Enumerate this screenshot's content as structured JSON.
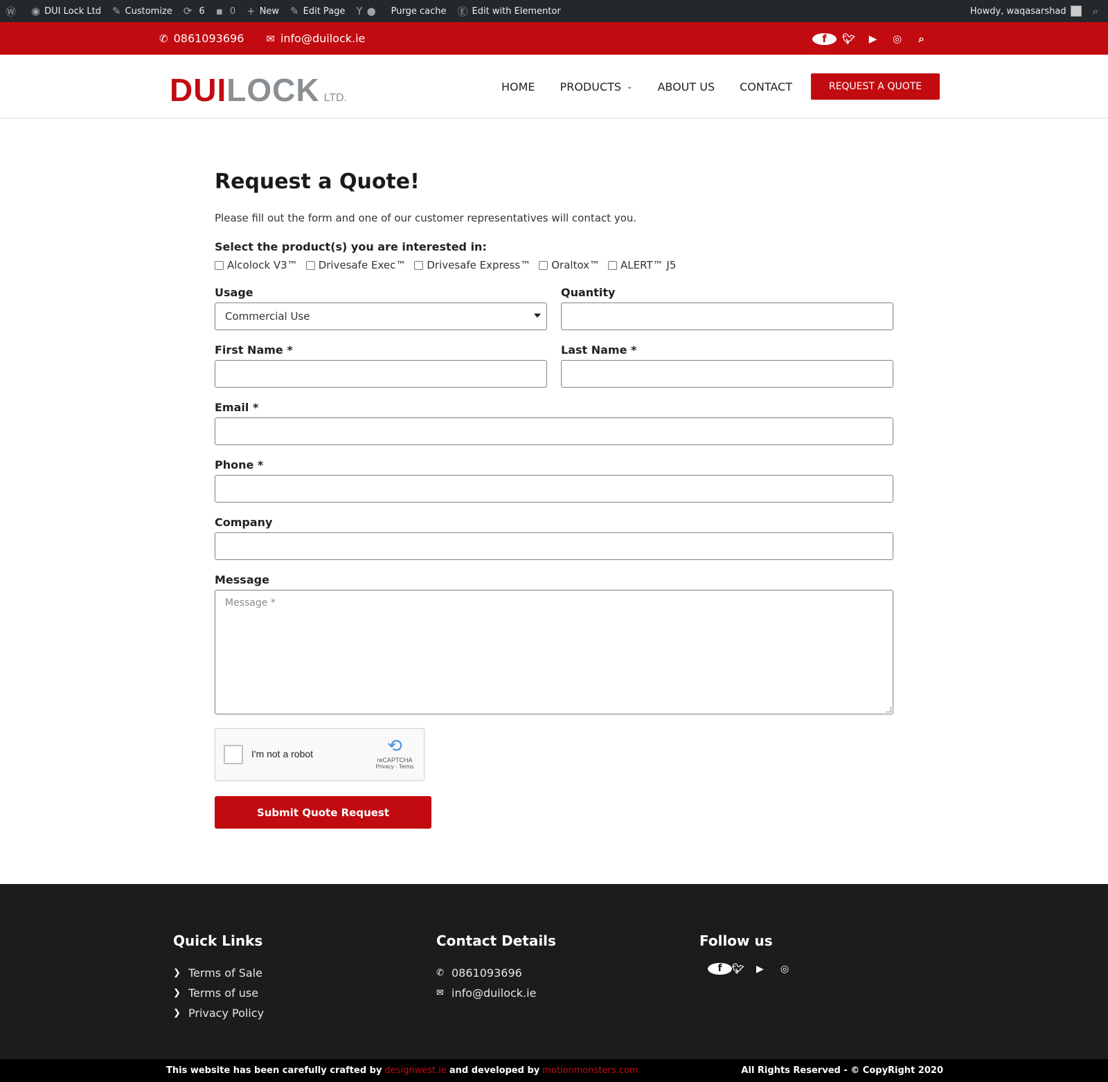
{
  "admin_bar": {
    "site_name": "DUI Lock Ltd",
    "customize": "Customize",
    "updates_count": "6",
    "comments_count": "0",
    "new_label": "New",
    "edit_page": "Edit Page",
    "purge_cache": "Purge cache",
    "edit_elementor": "Edit with Elementor",
    "howdy": "Howdy, waqasarshad"
  },
  "topbar": {
    "phone": "0861093696",
    "email": "info@duilock.ie",
    "social_icons": [
      "facebook-icon",
      "twitter-icon",
      "youtube-icon",
      "instagram-icon",
      "search-icon"
    ]
  },
  "header": {
    "logo": {
      "dui": "DUI",
      "lock": "LOCK",
      "ltd": "LTD."
    },
    "nav": [
      "HOME",
      "PRODUCTS",
      "ABOUT US",
      "CONTACT"
    ],
    "quote_button": "REQUEST A QUOTE"
  },
  "form": {
    "title": "Request a Quote!",
    "intro": "Please fill out the form and one of our customer representatives will contact you.",
    "products_label": "Select the product(s) you are interested in:",
    "products": [
      "Alcolock V3™",
      "Drivesafe Exec™",
      "Drivesafe Express™",
      "Oraltox™",
      "ALERT™ J5"
    ],
    "usage_label": "Usage",
    "usage_value": "Commercial Use",
    "quantity_label": "Quantity",
    "first_name_label": "First Name *",
    "last_name_label": "Last Name *",
    "email_label": "Email *",
    "phone_label": "Phone *",
    "company_label": "Company",
    "message_label": "Message",
    "message_placeholder": "Message *",
    "captcha_label": "I'm not a robot",
    "captcha_brand": "reCAPTCHA",
    "captcha_terms": "Privacy - Terms",
    "submit": "Submit Quote Request"
  },
  "footer": {
    "quick_links_title": "Quick Links",
    "quick_links": [
      "Terms of Sale",
      "Terms of use",
      "Privacy Policy"
    ],
    "contact_title": "Contact Details",
    "contact_phone": "0861093696",
    "contact_email": "info@duilock.ie",
    "follow_title": "Follow us",
    "credit_prefix": "This website has been carefully crafted by",
    "credit_design": "designwest.ie",
    "credit_mid": "and developed by",
    "credit_dev": "motionmonsters.com",
    "copyright": "All Rights Reserved - © CopyRight 2020"
  },
  "colors": {
    "brand_red": "#c20a11",
    "admin_bar": "#23282d",
    "footer": "#1c1c1c"
  }
}
